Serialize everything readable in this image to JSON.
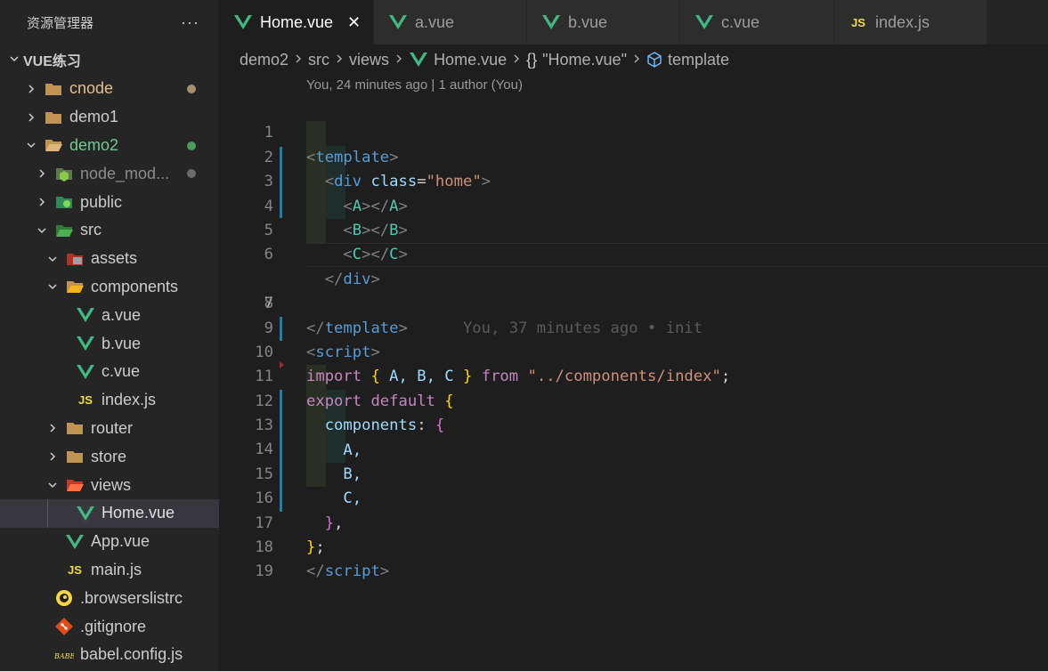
{
  "sidebar": {
    "title": "资源管理器",
    "more": "···",
    "workspace": "VUE练习",
    "items": [
      {
        "label": "cnode",
        "icon": "folder-icon",
        "color": "orange",
        "dot": "#a8906b"
      },
      {
        "label": "demo1",
        "icon": "folder-icon",
        "color": "grey"
      },
      {
        "label": "demo2",
        "icon": "folder-open-icon",
        "color": "green",
        "dot": "#4e9a5c"
      },
      {
        "label": "node_mod...",
        "icon": "node-modules-folder-icon",
        "color": "dim",
        "dot": "#6b6b6b"
      },
      {
        "label": "public",
        "icon": "public-folder-icon",
        "color": "grey"
      },
      {
        "label": "src",
        "icon": "src-folder-icon",
        "color": "grey"
      },
      {
        "label": "assets",
        "icon": "assets-folder-icon",
        "color": "grey"
      },
      {
        "label": "components",
        "icon": "components-folder-icon",
        "color": "grey"
      },
      {
        "label": "a.vue",
        "icon": "vue-icon",
        "color": "grey"
      },
      {
        "label": "b.vue",
        "icon": "vue-icon",
        "color": "grey"
      },
      {
        "label": "c.vue",
        "icon": "vue-icon",
        "color": "grey"
      },
      {
        "label": "index.js",
        "icon": "js-icon",
        "color": "grey"
      },
      {
        "label": "router",
        "icon": "folder-icon",
        "color": "grey"
      },
      {
        "label": "store",
        "icon": "folder-icon",
        "color": "grey"
      },
      {
        "label": "views",
        "icon": "views-folder-icon",
        "color": "grey"
      },
      {
        "label": "Home.vue",
        "icon": "vue-icon",
        "color": "grey"
      },
      {
        "label": "App.vue",
        "icon": "vue-icon",
        "color": "grey"
      },
      {
        "label": "main.js",
        "icon": "js-icon",
        "color": "grey"
      },
      {
        "label": ".browserslistrc",
        "icon": "browserslist-icon",
        "color": "grey"
      },
      {
        "label": ".gitignore",
        "icon": "git-icon",
        "color": "grey"
      },
      {
        "label": "babel.config.js",
        "icon": "babel-icon",
        "color": "grey"
      }
    ]
  },
  "tabs": [
    {
      "label": "Home.vue",
      "icon": "vue-icon",
      "active": true,
      "close": "✕"
    },
    {
      "label": "a.vue",
      "icon": "vue-icon"
    },
    {
      "label": "b.vue",
      "icon": "vue-icon"
    },
    {
      "label": "c.vue",
      "icon": "vue-icon"
    },
    {
      "label": "index.js",
      "icon": "js-icon"
    }
  ],
  "breadcrumb": {
    "parts": [
      "demo2",
      "src",
      "views",
      "Home.vue",
      "\"Home.vue\"",
      "template"
    ],
    "braces": "{}"
  },
  "codelens": "You, 24 minutes ago | 1 author (You)",
  "blame": "You, 37 minutes ago • init",
  "line_numbers": [
    "1",
    "2",
    "3",
    "4",
    "5",
    "6",
    "7",
    "8",
    "9",
    "10",
    "11",
    "12",
    "13",
    "14",
    "15",
    "16",
    "17",
    "18",
    "19"
  ],
  "code": {
    "l1": [
      "<",
      "template",
      ">"
    ],
    "l2": [
      "<",
      "div",
      "class",
      "=",
      "\"home\"",
      ">"
    ],
    "l3": [
      "<",
      "A",
      "></",
      "A",
      ">"
    ],
    "l4": [
      "<",
      "B",
      "></",
      "B",
      ">"
    ],
    "l5": [
      "<",
      "C",
      "></",
      "C",
      ">"
    ],
    "l6": [
      "</",
      "div",
      ">"
    ],
    "l7": [
      "</",
      "template",
      ">"
    ],
    "l9": [
      "<",
      "script",
      ">"
    ],
    "l10": [
      "import",
      "{",
      "A,",
      "B,",
      "C",
      "}",
      "from",
      "\"../components/index\"",
      ";"
    ],
    "l11": [
      "export",
      "default",
      "{"
    ],
    "l12": [
      "components",
      ":",
      "{"
    ],
    "l13": [
      "A,"
    ],
    "l14": [
      "B,"
    ],
    "l15": [
      "C,"
    ],
    "l16": [
      "}",
      ","
    ],
    "l17": [
      "}",
      ";"
    ],
    "l18": [
      "</",
      "script",
      ">"
    ]
  }
}
